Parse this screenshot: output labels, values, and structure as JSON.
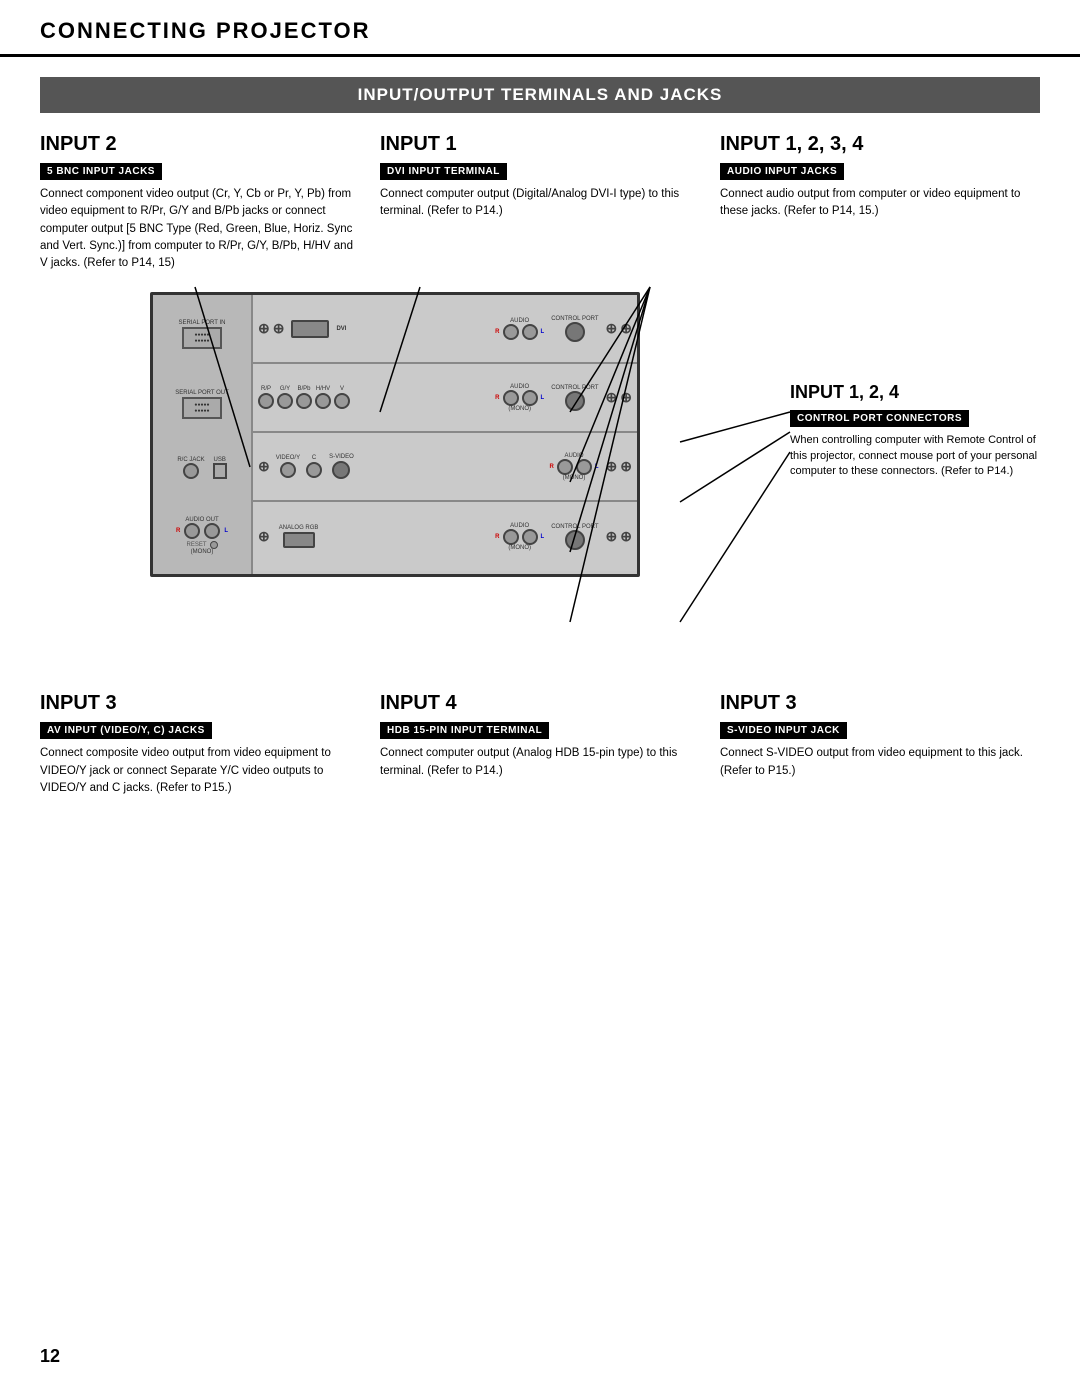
{
  "header": {
    "title": "CONNECTING PROJECTOR"
  },
  "section": {
    "title": "INPUT/OUTPUT TERMINALS AND JACKS"
  },
  "page_number": "12",
  "input2": {
    "heading": "INPUT 2",
    "tag": "5 BNC INPUT JACKS",
    "description": "Connect component video output (Cr, Y, Cb or Pr, Y, Pb) from video equipment to R/Pr, G/Y and B/Pb jacks or connect computer output [5 BNC Type (Red, Green, Blue, Horiz. Sync and Vert. Sync.)] from computer to R/Pr, G/Y, B/Pb, H/HV and V jacks. (Refer to P14, 15)"
  },
  "input1": {
    "heading": "INPUT 1",
    "tag": "DVI INPUT TERMINAL",
    "description": "Connect computer output (Digital/Analog DVI-I type) to this terminal. (Refer to P14.)"
  },
  "input1234_top": {
    "heading": "INPUT 1, 2, 3, 4",
    "tag": "AUDIO INPUT JACKS",
    "description": "Connect audio output from computer or video equipment to these jacks. (Refer to P14, 15.)"
  },
  "input124_right": {
    "heading": "INPUT 1, 2, 4",
    "tag": "CONTROL PORT CONNECTORS",
    "description": "When controlling computer with Remote Control of this projector, connect mouse port of your personal computer to these connectors. (Refer to P14.)"
  },
  "input3_bottom_left": {
    "heading": "INPUT 3",
    "tag": "AV INPUT (VIDEO/Y, C) JACKS",
    "description": "Connect composite video output from video equipment to VIDEO/Y jack or connect Separate Y/C video outputs to VIDEO/Y and C jacks. (Refer to P15.)"
  },
  "input4_bottom": {
    "heading": "INPUT 4",
    "tag": "HDB 15-PIN INPUT TERMINAL",
    "description": "Connect computer output (Analog HDB 15-pin type) to this terminal. (Refer to P14.)"
  },
  "input3_bottom_right": {
    "heading": "INPUT 3",
    "tag": "S-VIDEO INPUT JACK",
    "description": "Connect S-VIDEO output from video equipment to this jack. (Refer to P15.)"
  }
}
